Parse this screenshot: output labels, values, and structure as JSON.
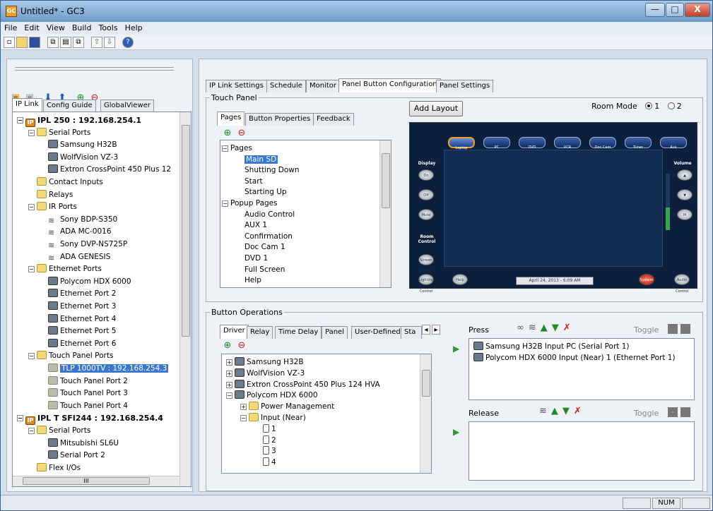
{
  "window": {
    "title": "Untitled* - GC3",
    "min_label": "—",
    "max_label": "□",
    "close_label": "X",
    "app_icon": "GC"
  },
  "menu": [
    "File",
    "Edit",
    "View",
    "Build",
    "Tools",
    "Help"
  ],
  "toolbar_icons": [
    "new-icon",
    "open-icon",
    "save-icon",
    "copy-icon",
    "paste-icon",
    "duplicate-icon",
    "upload-icon",
    "download-icon",
    "help-icon"
  ],
  "left": {
    "tabs": [
      "IP Link",
      "Config Guide",
      "GlobalViewer"
    ],
    "tools": [
      "add-controller-icon",
      "remove-controller-icon",
      "move-down-icon",
      "move-up-icon",
      "add-icon",
      "remove-icon"
    ],
    "tree": [
      {
        "label": "IPL 250 : 192.168.254.1",
        "level": 0,
        "type": "logo",
        "bold": true,
        "exp": "-"
      },
      {
        "label": "Serial Ports",
        "level": 1,
        "type": "folder",
        "exp": "-"
      },
      {
        "label": "Samsung H32B",
        "level": 2,
        "type": "dev"
      },
      {
        "label": "WolfVision VZ-3",
        "level": 2,
        "type": "dev"
      },
      {
        "label": "Extron CrossPoint 450 Plus 12",
        "level": 2,
        "type": "dev"
      },
      {
        "label": "Contact Inputs",
        "level": 1,
        "type": "folder"
      },
      {
        "label": "Relays",
        "level": 1,
        "type": "folder"
      },
      {
        "label": "IR Ports",
        "level": 1,
        "type": "folder",
        "exp": "-"
      },
      {
        "label": "Sony BDP-S350",
        "level": 2,
        "type": "ir"
      },
      {
        "label": "ADA MC-0016",
        "level": 2,
        "type": "ir"
      },
      {
        "label": "Sony DVP-NS725P",
        "level": 2,
        "type": "ir"
      },
      {
        "label": "ADA GENESIS",
        "level": 2,
        "type": "ir"
      },
      {
        "label": "Ethernet Ports",
        "level": 1,
        "type": "folder",
        "exp": "-"
      },
      {
        "label": "Polycom HDX 6000",
        "level": 2,
        "type": "dev"
      },
      {
        "label": "Ethernet Port 2",
        "level": 2,
        "type": "dev"
      },
      {
        "label": "Ethernet Port 3",
        "level": 2,
        "type": "dev"
      },
      {
        "label": "Ethernet Port 4",
        "level": 2,
        "type": "dev"
      },
      {
        "label": "Ethernet Port 5",
        "level": 2,
        "type": "dev"
      },
      {
        "label": "Ethernet Port 6",
        "level": 2,
        "type": "dev"
      },
      {
        "label": "Touch Panel Ports",
        "level": 1,
        "type": "folder",
        "exp": "-"
      },
      {
        "label": "TLP 1000TV : 192.168.254.3",
        "level": 2,
        "type": "tp",
        "sel": true
      },
      {
        "label": "Touch Panel Port 2",
        "level": 2,
        "type": "tp"
      },
      {
        "label": "Touch Panel Port 3",
        "level": 2,
        "type": "tp"
      },
      {
        "label": "Touch Panel Port 4",
        "level": 2,
        "type": "tp"
      },
      {
        "label": "IPL T SFI244 : 192.168.254.4",
        "level": 0,
        "type": "logo",
        "bold": true,
        "exp": "-"
      },
      {
        "label": "Serial Ports",
        "level": 1,
        "type": "folder",
        "exp": "-"
      },
      {
        "label": "Mitsubishi SL6U",
        "level": 2,
        "type": "dev"
      },
      {
        "label": "Serial Port 2",
        "level": 2,
        "type": "dev"
      },
      {
        "label": "Flex I/Os",
        "level": 1,
        "type": "folder"
      }
    ],
    "hscroll_grip": "III"
  },
  "right": {
    "tabs": [
      "IP Link Settings",
      "Schedule",
      "Monitor",
      "Panel Button Configuration",
      "Panel Settings"
    ],
    "touch_panel": {
      "label": "Touch Panel",
      "subtabs": [
        "Pages",
        "Button Properties",
        "Feedback"
      ],
      "add_layout": "Add Layout",
      "room_mode": "Room Mode",
      "room_options": [
        "1",
        "2"
      ],
      "pages_tree": [
        {
          "label": "Pages",
          "level": 0,
          "exp": "-"
        },
        {
          "label": "Main SD",
          "level": 1,
          "sel": true
        },
        {
          "label": "Shutting Down",
          "level": 1
        },
        {
          "label": "Start",
          "level": 1
        },
        {
          "label": "Starting Up",
          "level": 1
        },
        {
          "label": "Popup Pages",
          "level": 0,
          "exp": "-"
        },
        {
          "label": "Audio Control",
          "level": 1
        },
        {
          "label": "AUX 1",
          "level": 1
        },
        {
          "label": "Confirmation",
          "level": 1
        },
        {
          "label": "Doc Cam 1",
          "level": 1
        },
        {
          "label": "DVD 1",
          "level": 1
        },
        {
          "label": "Full Screen",
          "level": 1
        },
        {
          "label": "Help",
          "level": 1
        }
      ],
      "panel": {
        "sources": [
          "Laptop",
          "PC",
          "DVD",
          "VCR",
          "Doc Cam",
          "Tuner",
          "Aux"
        ],
        "display": "Display",
        "on": "On",
        "off": "Off",
        "mute": "Mute",
        "room_control": "Room Control",
        "screen_control": "Screen Control",
        "lighting_control": "Lighting Control",
        "help": "Help",
        "date": "April 24, 2013 - 6:09 AM",
        "system_off": "System Off",
        "volume": "Volume",
        "audio_control": "Audio Control"
      }
    },
    "ops": {
      "label": "Button Operations",
      "subtabs": [
        "Driver",
        "Relay",
        "Time Delay",
        "Panel",
        "User-Defined",
        "Sta"
      ],
      "tree": [
        {
          "label": "Samsung H32B",
          "level": 0,
          "exp": "+"
        },
        {
          "label": "WolfVision VZ-3",
          "level": 0,
          "exp": "+"
        },
        {
          "label": "Extron CrossPoint 450 Plus 124 HVA",
          "level": 0,
          "exp": "+"
        },
        {
          "label": "Polycom HDX 6000",
          "level": 0,
          "exp": "-"
        },
        {
          "label": "Power Management",
          "level": 1,
          "exp": "+"
        },
        {
          "label": "Input (Near)",
          "level": 1,
          "exp": "-"
        },
        {
          "label": "1",
          "level": 2
        },
        {
          "label": "2",
          "level": 2
        },
        {
          "label": "3",
          "level": 2
        },
        {
          "label": "4",
          "level": 2
        }
      ],
      "press_label": "Press",
      "press_items": [
        "Samsung H32B Input PC (Serial Port 1)",
        "Polycom HDX 6000 Input (Near) 1 (Ethernet Port 1)"
      ],
      "release_label": "Release",
      "toggle": "Toggle"
    }
  },
  "status": {
    "num": "NUM"
  }
}
